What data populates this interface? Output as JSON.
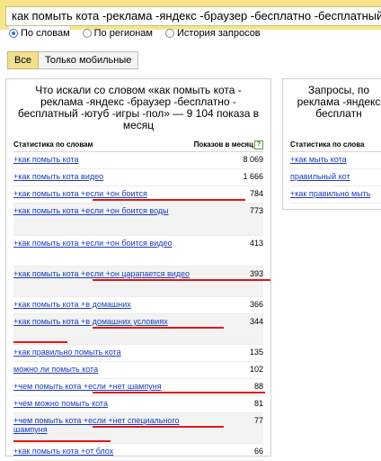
{
  "search": {
    "query": "как помыть кота -реклама -яндекс -браузер -бесплатно -бесплатный -ютуб -игры -пол"
  },
  "modes": [
    {
      "label": "По словам",
      "selected": true
    },
    {
      "label": "По регионам",
      "selected": false
    },
    {
      "label": "История запросов",
      "selected": false
    }
  ],
  "tabs": [
    {
      "label": "Все",
      "active": true
    },
    {
      "label": "Только мобильные",
      "active": false
    }
  ],
  "left_panel": {
    "title": "Что искали со словом «как помыть кота - реклама -яндекс -браузер -бесплатно - бесплатный -ютуб -игры -пол» — 9 104 показа в месяц",
    "col_phrase": "Статистика по словам",
    "col_count": "Показов в месяц",
    "help": "?",
    "rows": [
      {
        "phrase": "+как помыть кота",
        "count": "8 069"
      },
      {
        "phrase": "+как помыть кота видео",
        "count": "1 666"
      },
      {
        "phrase": "+как помыть кота +если +он боится",
        "count": "784"
      },
      {
        "phrase": "+как помыть кота +если +он боится воды",
        "count": "773"
      },
      {
        "phrase": "+как помыть кота +если +он боится видео",
        "count": "413"
      },
      {
        "phrase": "+как помыть кота +если +он царапается видео",
        "count": "393"
      },
      {
        "phrase": "+как помыть кота +в домашних",
        "count": "366"
      },
      {
        "phrase": "+как помыть кота +в домашних условиях",
        "count": "344"
      },
      {
        "phrase": "+как правильно помыть кота",
        "count": "135"
      },
      {
        "phrase": "можно ли помыть кота",
        "count": "102"
      },
      {
        "phrase": "+чем помыть кота +если +нет шампуня",
        "count": "88"
      },
      {
        "phrase": "+чем можно помыть кота",
        "count": "81"
      },
      {
        "phrase": "+чем помыть кота +если +нет специального шампуня",
        "count": "77"
      },
      {
        "phrase": "+как помыть кота +от блох",
        "count": "66"
      }
    ]
  },
  "right_panel": {
    "title": "Запросы, по реклама -яндекс бесплатн",
    "col_phrase": "Статистика по слова",
    "rows": [
      {
        "phrase": "+как мыть кота"
      },
      {
        "phrase": "правильный кот"
      },
      {
        "phrase": "+как правильно мыть"
      }
    ]
  },
  "colors": {
    "highlight_underline": "#e01818",
    "link": "#1a3dbb",
    "search_bar": "#f6e58a"
  }
}
